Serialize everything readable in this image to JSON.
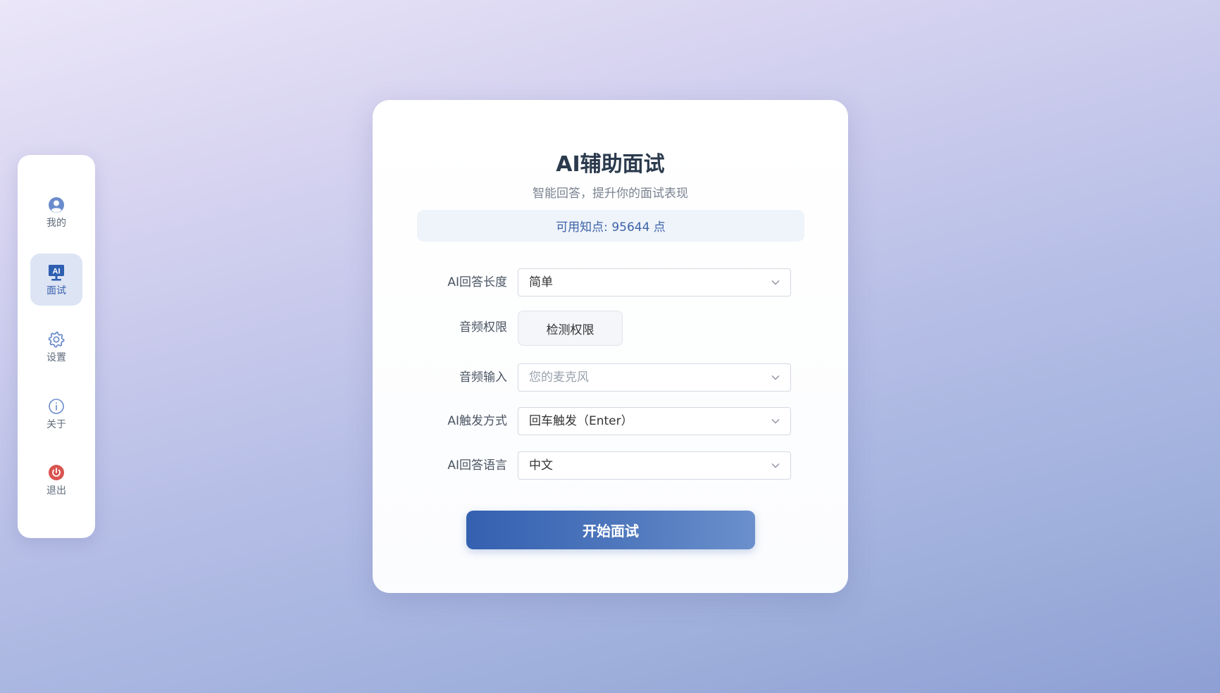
{
  "sidebar": {
    "items": [
      {
        "label": "我的",
        "icon": "user-circle-icon",
        "active": false
      },
      {
        "label": "面试",
        "icon": "ai-monitor-icon",
        "active": true
      },
      {
        "label": "设置",
        "icon": "gear-icon",
        "active": false
      },
      {
        "label": "关于",
        "icon": "info-icon",
        "active": false
      },
      {
        "label": "退出",
        "icon": "power-icon",
        "active": false
      }
    ]
  },
  "main": {
    "title": "AI辅助面试",
    "subtitle": "智能回答，提升你的面试表现",
    "points_text": "可用知点: 95644 点",
    "form": {
      "answer_length": {
        "label": "AI回答长度",
        "value": "简单"
      },
      "audio_permission": {
        "label": "音频权限",
        "button": "检测权限"
      },
      "audio_input": {
        "label": "音频输入",
        "placeholder": "您的麦克风"
      },
      "trigger_mode": {
        "label": "AI触发方式",
        "value": "回车触发（Enter）"
      },
      "answer_language": {
        "label": "AI回答语言",
        "value": "中文"
      }
    },
    "start_button": "开始面试"
  },
  "colors": {
    "accent": "#3a62ad",
    "active_nav_bg": "#dde4f4",
    "logout_red": "#d9534f",
    "title_text": "#2b3a4d"
  }
}
